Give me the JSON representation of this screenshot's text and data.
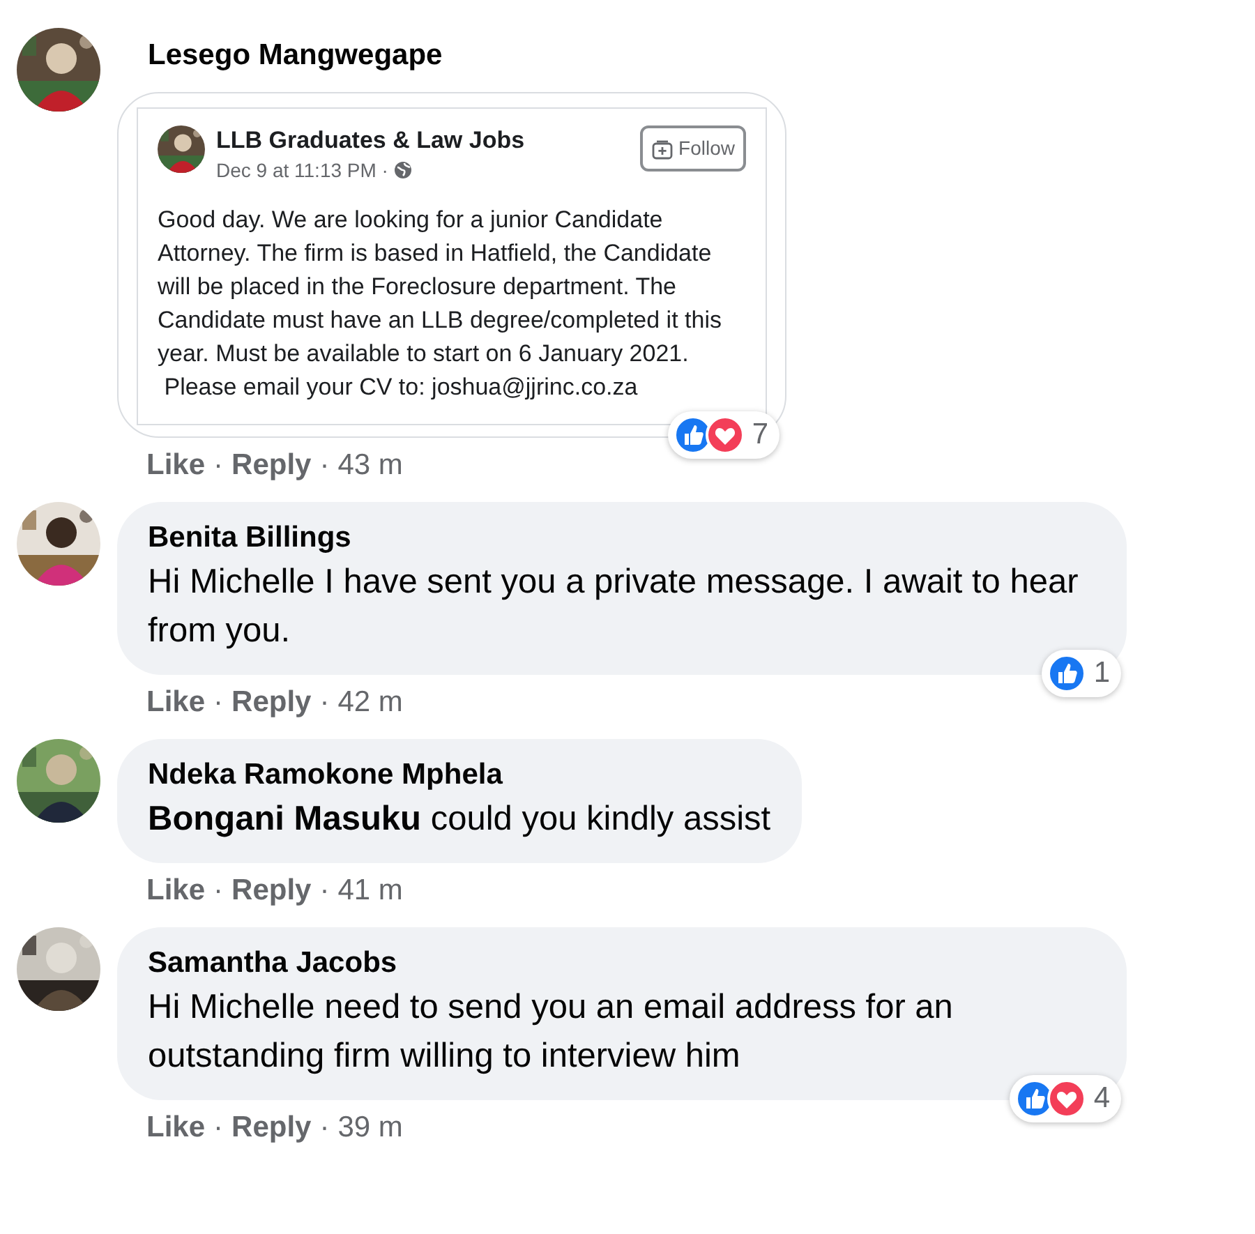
{
  "comments": [
    {
      "author": "Lesego Mangwegape",
      "attachment": {
        "page_name": "LLB Graduates & Law Jobs",
        "date": "Dec 9 at 11:13 PM ·",
        "follow_label": "Follow",
        "body": [
          "Good day. We are looking for a junior Candidate Attorney. The firm is based in Hatfield, the Candidate will be placed in the Foreclosure department. The Candidate must have an LLB degree/completed it this year. Must be available to start on 6 January 2021.",
          " Please email your CV to: joshua@jjrinc.co.za"
        ]
      },
      "reactions": {
        "icons": [
          {
            "kind": "like"
          },
          {
            "kind": "love"
          }
        ],
        "count": "7"
      },
      "actions": [
        "Like",
        "Reply"
      ],
      "separator": "·",
      "time": "43 m"
    },
    {
      "author": "Benita Billings",
      "text": "Hi Michelle I have sent you a private message. I await to hear from you.",
      "reactions": {
        "icons": [
          {
            "kind": "like"
          }
        ],
        "count": "1"
      },
      "actions": [
        "Like",
        "Reply"
      ],
      "separator": "·",
      "time": "42 m"
    },
    {
      "author": "Ndeka Ramokone Mphela",
      "text": "**Bongani Masuku** could you kindly assist",
      "actions": [
        "Like",
        "Reply"
      ],
      "separator": "·",
      "time": "41 m"
    },
    {
      "author": "Samantha Jacobs",
      "text": "Hi Michelle need to send you an email address for an outstanding firm willing to interview him",
      "reactions": {
        "icons": [
          {
            "kind": "like"
          },
          {
            "kind": "love"
          }
        ],
        "count": "4"
      },
      "actions": [
        "Like",
        "Reply"
      ],
      "separator": "·",
      "time": "39 m"
    }
  ]
}
